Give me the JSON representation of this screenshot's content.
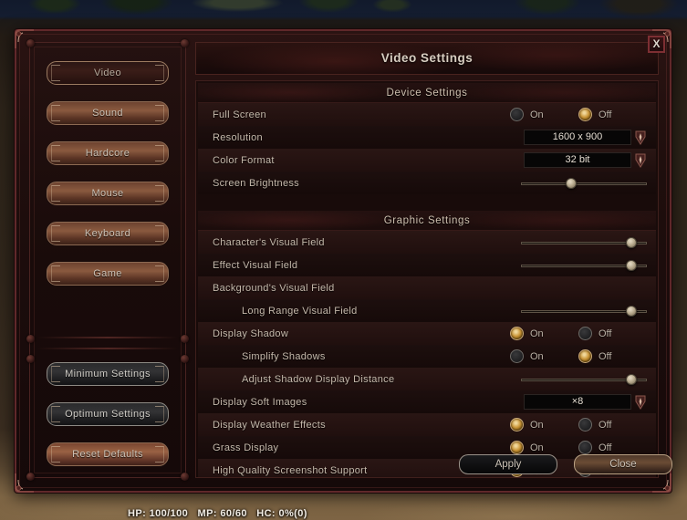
{
  "window": {
    "title": "Video Settings",
    "close_label": "X"
  },
  "sidebar": {
    "nav_items": [
      {
        "label": "Video",
        "state": "active"
      },
      {
        "label": "Sound",
        "state": "normal"
      },
      {
        "label": "Hardcore",
        "state": "normal"
      },
      {
        "label": "Mouse",
        "state": "normal"
      },
      {
        "label": "Keyboard",
        "state": "normal"
      },
      {
        "label": "Game",
        "state": "normal"
      }
    ],
    "preset_items": [
      {
        "label": "Minimum Settings",
        "state": "dark"
      },
      {
        "label": "Optimum Settings",
        "state": "dark"
      },
      {
        "label": "Reset Defaults",
        "state": "reset"
      }
    ]
  },
  "sections": [
    {
      "header": "Device Settings",
      "rows": [
        {
          "label": "Full Screen",
          "control": "radio",
          "value": "Off",
          "on_label": "On",
          "off_label": "Off"
        },
        {
          "label": "Resolution",
          "control": "dropdown",
          "value": "1600 x 900"
        },
        {
          "label": "Color Format",
          "control": "dropdown",
          "value": "32 bit"
        },
        {
          "label": "Screen Brightness",
          "control": "slider",
          "percent": 40
        }
      ]
    },
    {
      "header": "Graphic Settings",
      "rows": [
        {
          "label": "Character's Visual Field",
          "control": "slider",
          "percent": 88,
          "indent": 0
        },
        {
          "label": "Effect Visual Field",
          "control": "slider",
          "percent": 88,
          "indent": 0
        },
        {
          "label": "Background's Visual Field",
          "control": "none",
          "indent": 0
        },
        {
          "label": "Long Range Visual Field",
          "control": "slider",
          "percent": 88,
          "indent": 1
        },
        {
          "label": "Display Shadow",
          "control": "radio",
          "value": "On",
          "on_label": "On",
          "off_label": "Off",
          "indent": 0
        },
        {
          "label": "Simplify Shadows",
          "control": "radio",
          "value": "Off",
          "on_label": "On",
          "off_label": "Off",
          "indent": 1
        },
        {
          "label": "Adjust Shadow Display Distance",
          "control": "slider",
          "percent": 88,
          "indent": 1
        },
        {
          "label": "Display Soft Images",
          "control": "dropdown",
          "value": "×8",
          "indent": 0
        },
        {
          "label": "Display Weather Effects",
          "control": "radio",
          "value": "On",
          "on_label": "On",
          "off_label": "Off",
          "indent": 0
        },
        {
          "label": "Grass Display",
          "control": "radio",
          "value": "On",
          "on_label": "On",
          "off_label": "Off",
          "indent": 0
        },
        {
          "label": "High Quality Screenshot Support",
          "control": "radio",
          "value": "On",
          "on_label": "On",
          "off_label": "Off",
          "indent": 0
        }
      ]
    }
  ],
  "footer": {
    "apply_label": "Apply",
    "close_label": "Close"
  },
  "hud": {
    "status": "HP: 100/100   MP: 60/60   HC: 0%(0)"
  },
  "colors": {
    "accent_gold": "#c99436",
    "frame_red": "#60282a",
    "text_primary": "#c5b9ab"
  }
}
